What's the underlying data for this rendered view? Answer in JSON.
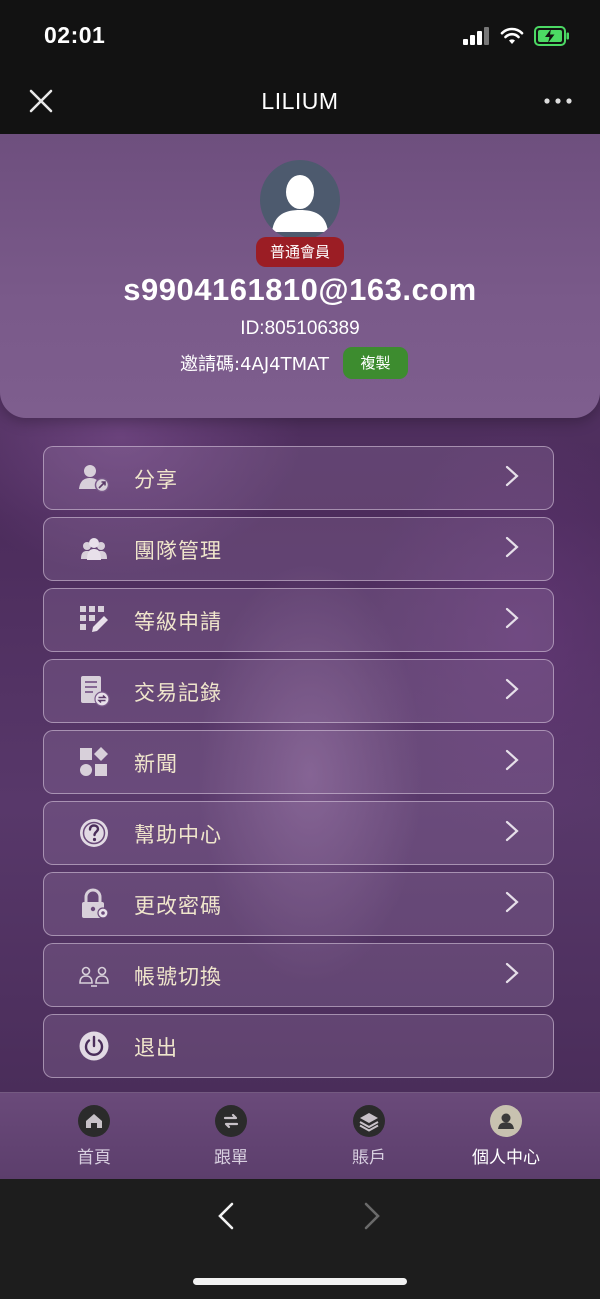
{
  "status_bar": {
    "time": "02:01"
  },
  "header": {
    "title": "LILIUM"
  },
  "profile": {
    "badge": "普通會員",
    "email": "s9904161810@163.com",
    "id_text": "ID:805106389",
    "invite_text": "邀請碼:4AJ4TMAT",
    "copy_label": "複製"
  },
  "menu": {
    "share": "分享",
    "team": "團隊管理",
    "level": "等級申請",
    "records": "交易記錄",
    "news": "新聞",
    "help": "幫助中心",
    "password": "更改密碼",
    "switch": "帳號切換",
    "logout": "退出"
  },
  "tabs": {
    "home": "首頁",
    "follow": "跟單",
    "account": "賬戶",
    "profile": "個人中心"
  },
  "colors": {
    "badge": "#9b1d24",
    "copy_button": "#3d8c2f",
    "menu_text": "#f0e6cc",
    "battery": "#4cd964"
  },
  "active_tab": "profile"
}
